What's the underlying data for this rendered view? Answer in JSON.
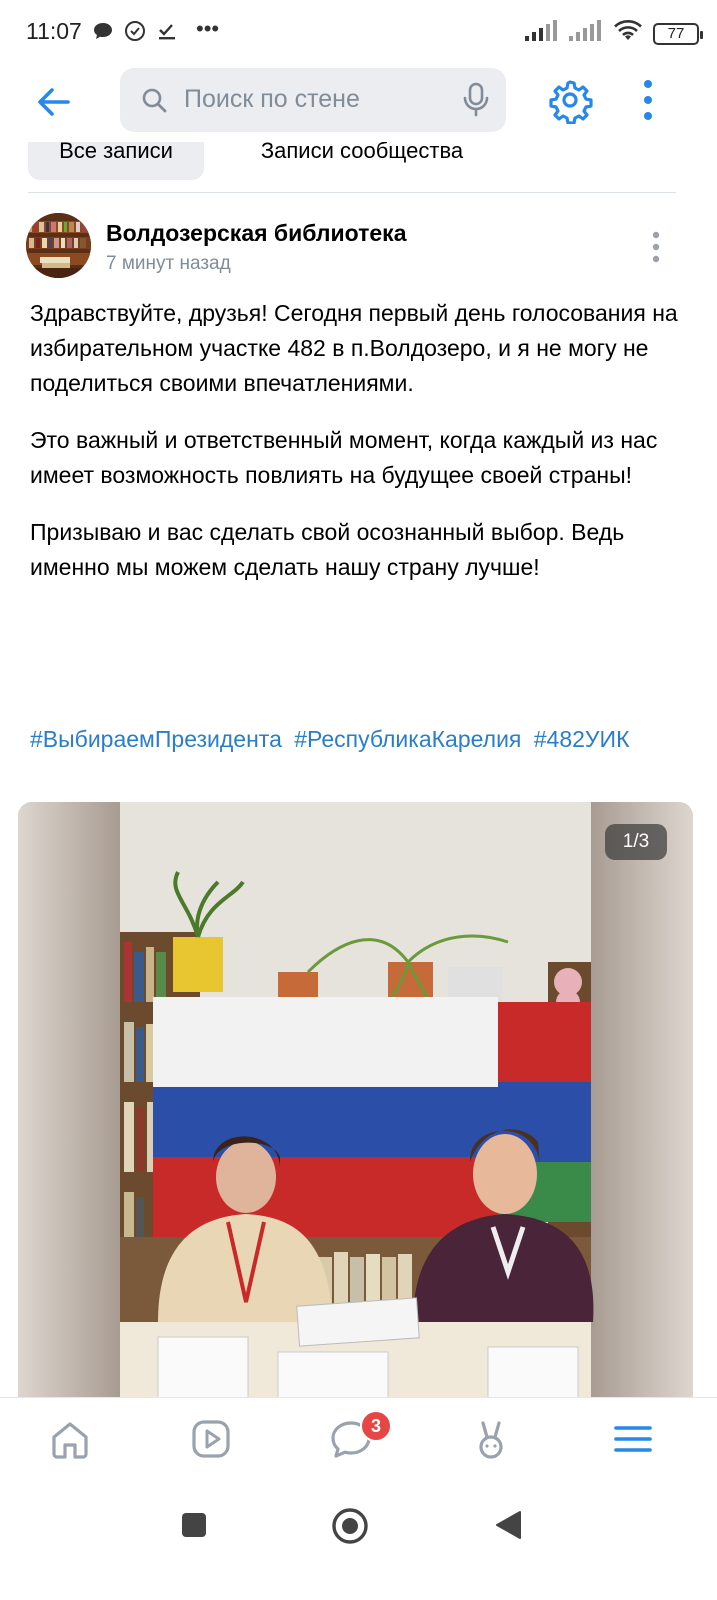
{
  "status_bar": {
    "time": "11:07",
    "battery": "77"
  },
  "search": {
    "placeholder": "Поиск по стене"
  },
  "tabs": [
    {
      "label": "Все записи"
    },
    {
      "label": "Записи сообщества"
    }
  ],
  "post": {
    "author": "Волдозерская библиотека",
    "time": "7 минут назад",
    "paragraphs": [
      "Здравствуйте, друзья! Сегодня первый день голосования на избирательном участке 482 в п.Волдозеро, и я не могу не поделиться своими впечатлениями.",
      "Это важный и ответственный момент, когда каждый из нас имеет возможность повлиять на будущее своей страны!",
      "Призываю и вас сделать свой осознанный выбор. Ведь именно мы можем сделать нашу страну лучше!"
    ],
    "hashtags": [
      "#ВыбираемПрезидента",
      "#РеспубликаКарелия",
      "#482УИК"
    ],
    "photo_counter": "1/3"
  },
  "bottom_nav": {
    "messages_badge": "3"
  },
  "colors": {
    "accent": "#2688eb",
    "link": "#2a7ec9",
    "badge": "#e64646"
  }
}
